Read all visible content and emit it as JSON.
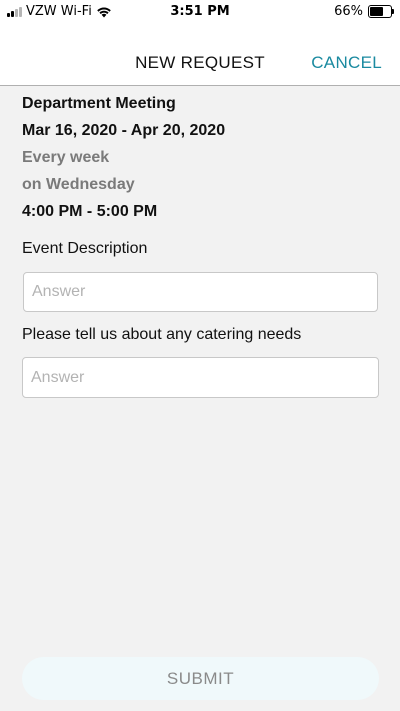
{
  "status_bar": {
    "carrier": "VZW Wi-Fi",
    "time": "3:51 PM",
    "battery_percent": "66%",
    "battery_level": 0.66,
    "signal_bars_filled": 2,
    "signal_bars_total": 4
  },
  "nav": {
    "title": "NEW REQUEST",
    "cancel_label": "CANCEL",
    "accent_color": "#1a8aa0"
  },
  "event": {
    "name": "Department Meeting",
    "date_range": "Mar 16, 2020 - Apr 20, 2020",
    "recurrence": "Every week",
    "day": "on Wednesday",
    "time_range": "4:00 PM - 5:00 PM"
  },
  "form": {
    "description_label": "Event Description",
    "description_placeholder": "Answer",
    "description_value": "",
    "catering_label": "Please tell us about any catering needs",
    "catering_placeholder": "Answer",
    "catering_value": ""
  },
  "submit": {
    "label": "SUBMIT"
  },
  "icons": {
    "signal": "cellular-signal-icon",
    "wifi": "wifi-icon",
    "battery": "battery-icon"
  }
}
